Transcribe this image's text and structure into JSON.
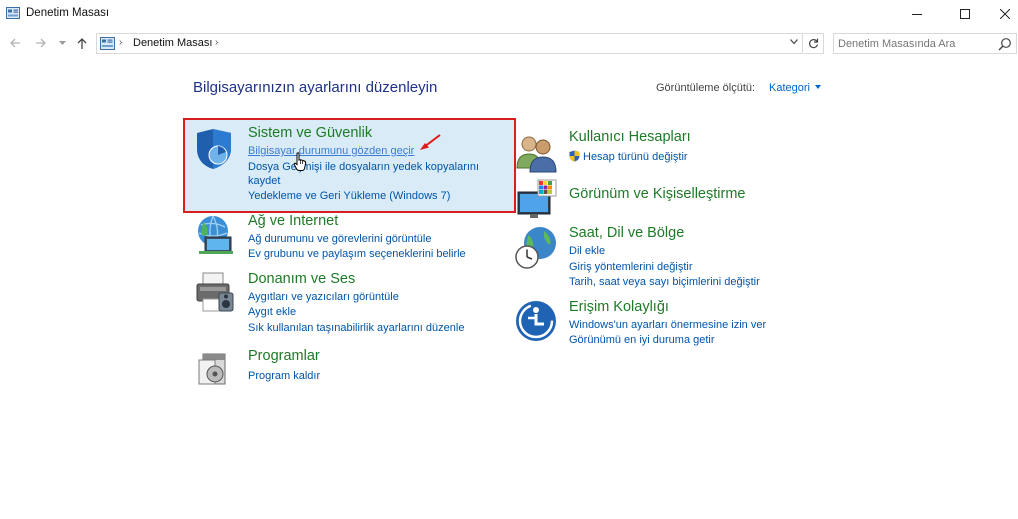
{
  "window": {
    "title": "Denetim Masası"
  },
  "address": {
    "path": "Denetim Masası",
    "search_placeholder": "Denetim Masasında Ara"
  },
  "header": {
    "heading": "Bilgisayarınızın ayarlarını düzenleyin",
    "view_label": "Görüntüleme ölçütü:",
    "view_value": "Kategori"
  },
  "categories": {
    "sistem": {
      "title": "Sistem ve Güvenlik",
      "links": [
        "Bilgisayar durumunu gözden geçir",
        "Dosya Geçmişi ile dosyaların yedek kopyalarını",
        "kaydet",
        "Yedekleme ve Geri Yükleme (Windows 7)"
      ]
    },
    "ag": {
      "title": "Ağ ve Internet",
      "links": [
        "Ağ durumunu ve görevlerini görüntüle",
        "Ev grubunu ve paylaşım seçeneklerini belirle"
      ]
    },
    "donanim": {
      "title": "Donanım ve Ses",
      "links": [
        "Aygıtları ve yazıcıları görüntüle",
        "Aygıt ekle",
        "Sık kullanılan taşınabilirlik ayarlarını düzenle"
      ]
    },
    "programlar": {
      "title": "Programlar",
      "links": [
        "Program kaldır"
      ]
    },
    "kullanici": {
      "title": "Kullanıcı Hesapları",
      "links": [
        "Hesap türünü değiştir"
      ]
    },
    "gorunum": {
      "title": "Görünüm ve Kişiselleştirme",
      "links": []
    },
    "saat": {
      "title": "Saat, Dil ve Bölge",
      "links": [
        "Dil ekle",
        "Giriş yöntemlerini değiştir",
        "Tarih, saat veya sayı biçimlerini değiştir"
      ]
    },
    "erisim": {
      "title": "Erişim Kolaylığı",
      "links": [
        "Windows'un ayarları önermesine izin ver",
        "Görünümü en iyi duruma getir"
      ]
    }
  },
  "colors": {
    "category_title": "#1e7a27",
    "link": "#0055aa",
    "heading": "#1e3287",
    "highlight_border": "#d81e1e",
    "highlight_fill": "#d9ebf7"
  }
}
